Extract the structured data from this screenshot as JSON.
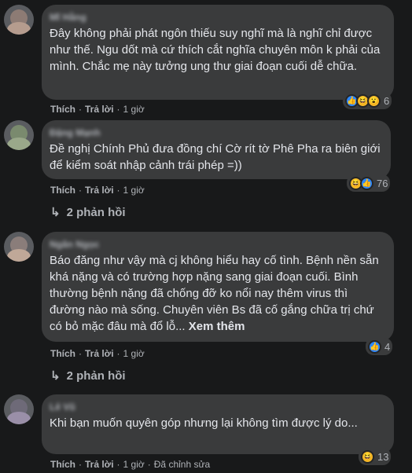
{
  "comments": [
    {
      "author": "Mĩ Hằng",
      "text": "Đây không phải phát ngôn thiếu suy nghĩ mà là nghĩ chỉ được như thế. Ngu dốt mà cứ thích cắt nghĩa chuyên môn k phải của mình. Chắc mẹ này tưởng ung thư giai đoạn cuối dễ chữa.",
      "like": "Thích",
      "reply": "Trả lời",
      "time": "1 giờ",
      "reaction_count": "6",
      "reaction_icons": [
        "like-icon",
        "haha-icon",
        "wow-icon"
      ]
    },
    {
      "author": "Đặng Mạnh",
      "text": "Đề nghị Chính Phủ đưa đồng chí Cờ rít tờ Phê Pha ra biên giới để kiểm soát nhập cảnh trái phép =))",
      "like": "Thích",
      "reply": "Trả lời",
      "time": "1 giờ",
      "reaction_count": "76",
      "reaction_icons": [
        "haha-icon",
        "like-icon"
      ],
      "replies": "2 phản hồi"
    },
    {
      "author": "Ngân Ngọc",
      "text": "Báo đăng như vậy mà cj không hiểu hay cố tình. Bệnh nền sẵn khá nặng và có trường hợp nặng sang giai đoạn cuối. Bình thường bệnh nặng đã chống đỡ ko nổi nay thêm virus thì đường nào mà sống. Chuyên viên Bs đã cố gắng chữa trị chứ có bỏ mặc đâu mà đổ lỗ...",
      "see_more": "Xem thêm",
      "like": "Thích",
      "reply": "Trả lời",
      "time": "1 giờ",
      "reaction_count": "4",
      "reaction_icons": [
        "like-icon"
      ],
      "replies": "2 phản hồi"
    },
    {
      "author": "Lê Vũ",
      "text": "Khi bạn muốn quyên góp nhưng lại không tìm được lý do...",
      "like": "Thích",
      "reply": "Trả lời",
      "time": "1 giờ",
      "edited": "Đã chỉnh sửa",
      "reaction_count": "13",
      "reaction_icons": [
        "haha-icon"
      ]
    }
  ],
  "colors": {
    "background": "#18191a",
    "bubble": "#3a3b3c",
    "text": "#e4e6eb",
    "secondary": "#b0b3b8",
    "like_blue": "#2d88ff",
    "haha_yellow": "#f7b928"
  }
}
